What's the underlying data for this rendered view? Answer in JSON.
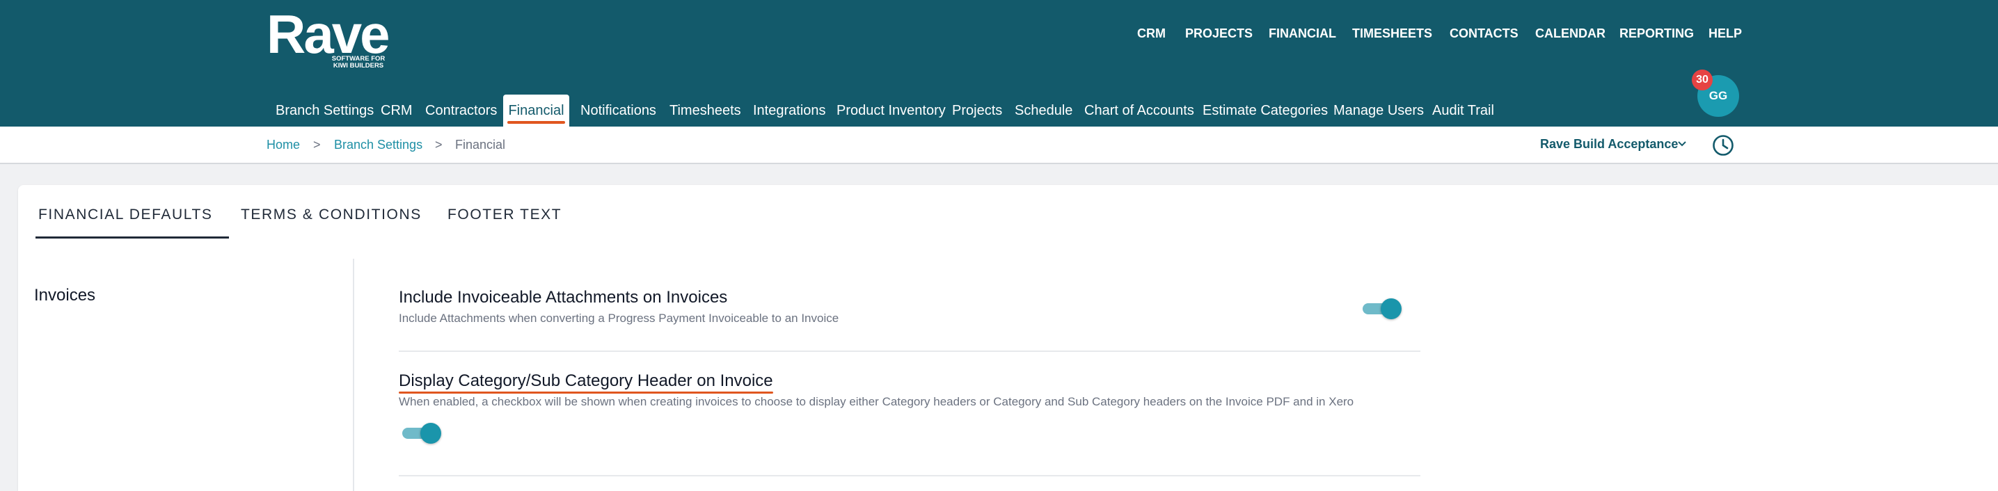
{
  "brand": {
    "name": "Rave",
    "tagline_line1": "SOFTWARE FOR",
    "tagline_line2": "KIWI BUILDERS"
  },
  "main_nav": [
    "CRM",
    "PROJECTS",
    "FINANCIAL",
    "TIMESHEETS",
    "CONTACTS",
    "CALENDAR",
    "REPORTING",
    "HELP"
  ],
  "sub_nav": {
    "items": [
      "Branch Settings",
      "CRM",
      "Contractors",
      "Financial",
      "Notifications",
      "Timesheets",
      "Integrations",
      "Product Inventory",
      "Projects",
      "Schedule",
      "Chart of Accounts",
      "Estimate Categories",
      "Manage Users",
      "Audit Trail"
    ],
    "active": "Financial"
  },
  "user": {
    "initials": "GG",
    "notification_count": "30"
  },
  "breadcrumb": {
    "home": "Home",
    "parent": "Branch Settings",
    "current": "Financial",
    "separator": ">"
  },
  "branch_selector": {
    "value": "Rave Build Acceptance"
  },
  "tabs": [
    "FINANCIAL DEFAULTS",
    "TERMS & CONDITIONS",
    "FOOTER TEXT"
  ],
  "active_tab": "FINANCIAL DEFAULTS",
  "section": {
    "label": "Invoices",
    "settings": [
      {
        "title": "Include Invoiceable Attachments on Invoices",
        "description": "Include Attachments when converting a Progress Payment Invoiceable to an Invoice",
        "enabled": true
      },
      {
        "title": "Display Category/Sub Category Header on Invoice",
        "description": "When enabled, a checkbox will be shown when creating invoices to choose to display either Category headers or Category and Sub Category headers on the Invoice PDF and in Xero",
        "enabled": true
      }
    ]
  },
  "colors": {
    "header_bg": "#135a6b",
    "accent_orange": "#e0561f",
    "toggle_on": "#1a95ab",
    "link": "#1e8fa5",
    "badge": "#e64343"
  },
  "icons": {
    "branch_dropdown": "chevron-down-icon",
    "history": "clock-icon"
  }
}
